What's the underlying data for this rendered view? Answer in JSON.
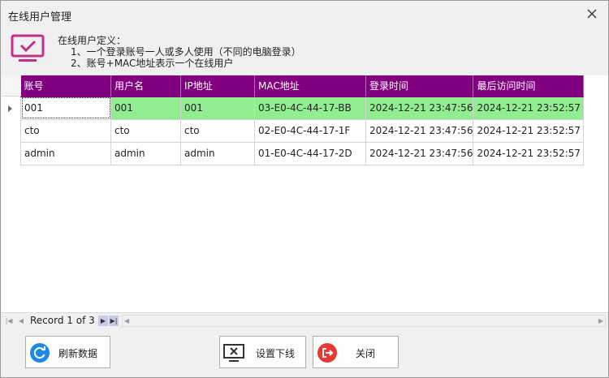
{
  "window": {
    "title": "在线用户管理"
  },
  "definition": {
    "title": "在线用户定义：",
    "line1": "1、一个登录账号一人或多人使用（不同的电脑登录）",
    "line2": "2、账号+MAC地址表示一个在线用户"
  },
  "grid": {
    "columns": [
      "账号",
      "用户名",
      "IP地址",
      "MAC地址",
      "登录时间",
      "最后访问时间"
    ],
    "rows": [
      [
        "001",
        "001",
        "001",
        "03-E0-4C-44-17-BB",
        "2024-12-21 23:47:56",
        "2024-12-21 23:52:57"
      ],
      [
        "cto",
        "cto",
        "cto",
        "02-E0-4C-44-17-1F",
        "2024-12-21 23:47:56",
        "2024-12-21 23:52:57"
      ],
      [
        "admin",
        "admin",
        "admin",
        "01-E0-4C-44-17-2D",
        "2024-12-21 23:47:56",
        "2024-12-21 23:52:57"
      ]
    ],
    "selected_row": 0,
    "selected_row_color": "#90ee90",
    "header_color": "#800080"
  },
  "navigator": {
    "record_text": "Record 1 of 3"
  },
  "buttons": {
    "refresh": "刷新数据",
    "set_offline": "设置下线",
    "close": "关闭"
  },
  "icons": {
    "header": "monitor-check-icon",
    "refresh": "refresh-icon",
    "set_offline": "monitor-x-icon",
    "close": "exit-icon"
  },
  "colors": {
    "accent": "#c0308c",
    "refresh_blue": "#1e88e5",
    "close_red": "#e53935"
  }
}
